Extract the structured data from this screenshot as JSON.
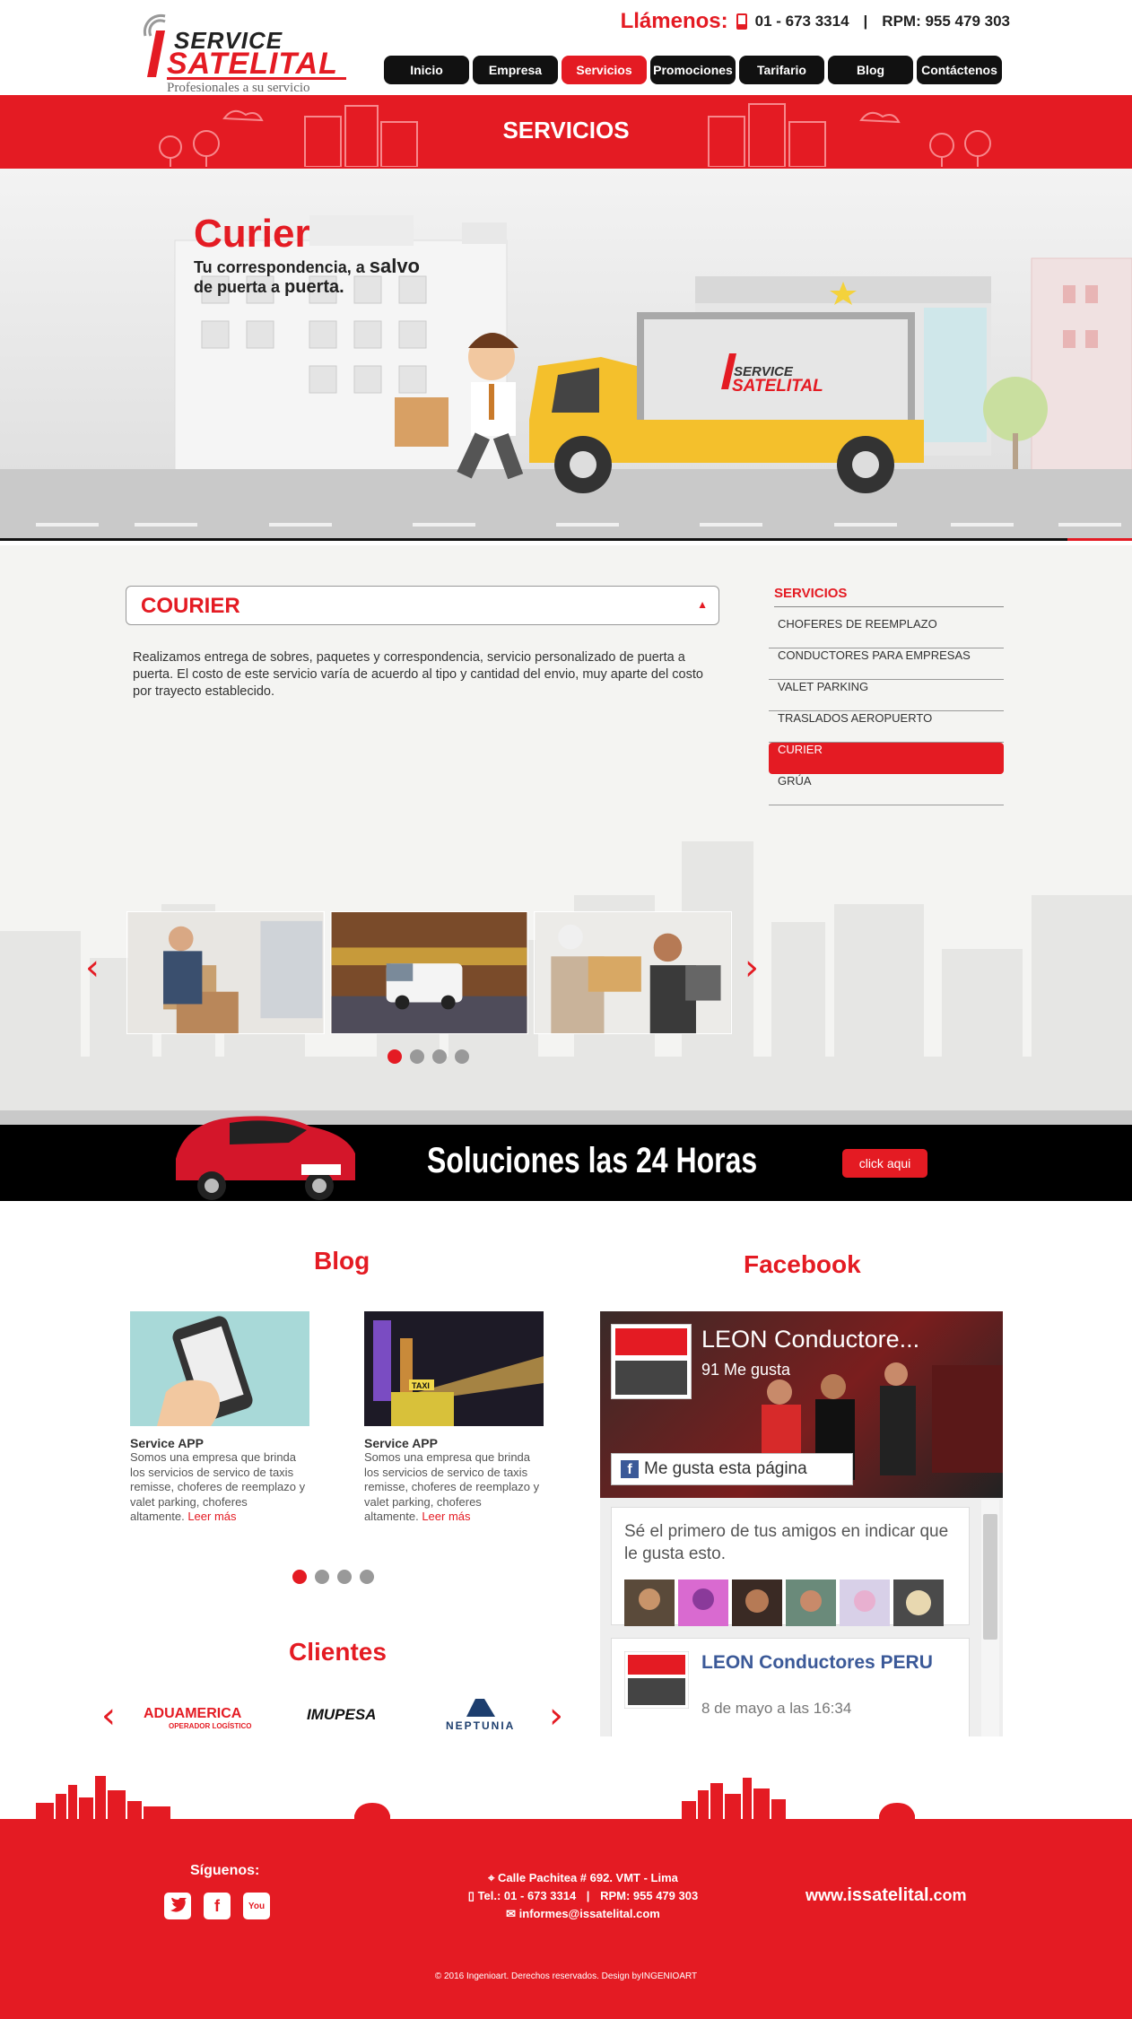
{
  "header": {
    "logo_service": "SERVICE",
    "logo_satelital": "SATELITAL",
    "tagline": "Profesionales a su servicio",
    "call_label": "Llámenos:",
    "phone": "01 - 673 3314",
    "separator": "|",
    "rpm": "RPM: 955 479 303"
  },
  "nav": {
    "items": [
      {
        "label": "Inicio",
        "active": false
      },
      {
        "label": "Empresa",
        "active": false
      },
      {
        "label": "Servicios",
        "active": true
      },
      {
        "label": "Promociones",
        "active": false
      },
      {
        "label": "Tarifario",
        "active": false
      },
      {
        "label": "Blog",
        "active": false
      },
      {
        "label": "Contáctenos",
        "active": false
      }
    ]
  },
  "band": {
    "title": "SERVICIOS"
  },
  "hero": {
    "title": "Curier",
    "sub_1": "Tu correspondencia, a",
    "sub_1b": "salvo",
    "sub_2": "de puerta a",
    "sub_2b": "puerta.",
    "truck_logo_1": "SERVICE",
    "truck_logo_2": "SATELITAL"
  },
  "service": {
    "title": "COURIER",
    "arrow": "▲",
    "description": "Realizamos entrega de sobres, paquetes y correspondencia, servicio personalizado de puerta a puerta. El costo de este servicio varía de acuerdo al tipo y cantidad del envio, muy aparte del costo por trayecto establecido."
  },
  "sidebar": {
    "title": "SERVICIOS",
    "items": [
      {
        "label": "CHOFERES DE REEMPLAZO",
        "active": false
      },
      {
        "label": "CONDUCTORES PARA EMPRESAS",
        "active": false
      },
      {
        "label": "VALET PARKING",
        "active": false
      },
      {
        "label": "TRASLADOS AEROPUERTO",
        "active": false
      },
      {
        "label": "CURIER",
        "active": true
      },
      {
        "label": "GRÚA",
        "active": false
      }
    ]
  },
  "gallery": {
    "prev": "‹",
    "next": "›",
    "dots": 4,
    "active_dot": 0
  },
  "promo": {
    "text": "Soluciones las 24 Horas",
    "button": "click aqui"
  },
  "blog": {
    "title": "Blog",
    "posts": [
      {
        "title": "Service APP",
        "text": "Somos una empresa que brinda los servicios de servico de taxis remisse, choferes de reemplazo y valet parking, choferes altamente.",
        "more": "Leer más"
      },
      {
        "title": "Service APP",
        "text": "Somos una empresa que brinda los servicios de servico de taxis remisse, choferes de reemplazo y valet parking, choferes altamente.",
        "more": "Leer más"
      }
    ],
    "dots": 4,
    "active_dot": 0
  },
  "facebook": {
    "title": "Facebook",
    "page_name": "LEON Conductore...",
    "likes": "91 Me gusta",
    "like_button": "Me gusta esta página",
    "prompt": "Sé el primero de tus amigos en indicar que le gusta esto.",
    "post_name": "LEON Conductores PERU",
    "post_date": "8 de mayo a las 16:34"
  },
  "clients": {
    "title": "Clientes",
    "prev": "‹",
    "next": "›",
    "logos": [
      "ADUAMERICA",
      "IMUPESA",
      "NEPTUNIA"
    ],
    "aduamerica_sub": "OPERADOR LOGÍSTICO"
  },
  "footer": {
    "follow": "Síguenos:",
    "address": "Calle Pachitea # 692. VMT - Lima",
    "phone": "Tel.: 01 - 673 3314",
    "separator": "|",
    "rpm": "RPM: 955 479 303",
    "email": "informes@issatelital.com",
    "web_prefix": "www.",
    "web_main": "issatelital",
    "web_suffix": ".com",
    "copyright": "© 2016 Ingenioart. Derechos reservados. Design byINGENIOART"
  },
  "colors": {
    "accent": "#e41b23",
    "dark": "#111111"
  }
}
